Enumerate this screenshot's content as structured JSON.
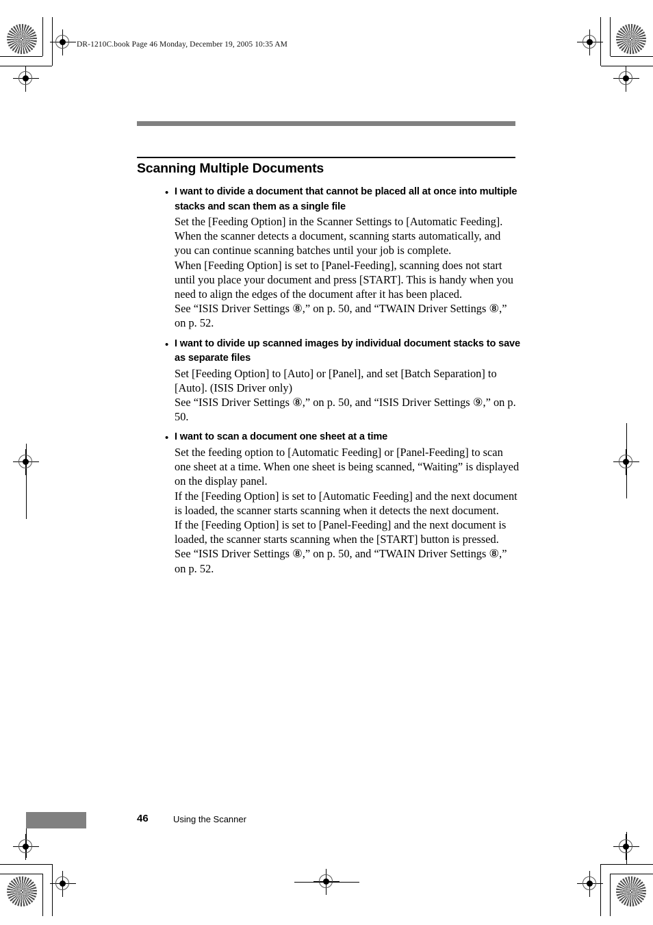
{
  "header": {
    "file_line": "DR-1210C.book  Page 46  Monday, December 19, 2005  10:35 AM"
  },
  "content": {
    "section_title": "Scanning Multiple Documents",
    "bullet_char": "•",
    "sections": [
      {
        "heading": "I want to divide a document that cannot be placed all at once into multiple stacks and scan them as a single file",
        "paragraphs": [
          "Set the [Feeding Option] in the Scanner Settings to [Automatic Feeding]. When the scanner detects a document, scanning starts automatically, and you can continue scanning batches until your job is complete.",
          "When [Feeding Option] is set to [Panel-Feeding], scanning does not start until you place your document and press [START]. This is handy when you need to align the edges of the document after it has been placed.",
          "See “ISIS Driver Settings ⑧,” on p. 50, and “TWAIN Driver Settings ⑧,” on p. 52."
        ]
      },
      {
        "heading": "I want to divide up scanned images by individual document stacks to save as separate files",
        "paragraphs": [
          "Set [Feeding Option] to [Auto] or [Panel], and set [Batch Separation] to [Auto]. (ISIS Driver only)",
          "See “ISIS Driver Settings ⑧,” on p. 50, and “ISIS Driver Settings ⑨,” on p. 50."
        ]
      },
      {
        "heading": "I want to scan a document one sheet at a time",
        "paragraphs": [
          "Set the feeding option to [Automatic Feeding] or [Panel-Feeding] to scan one sheet at a time. When one sheet is being scanned, “Waiting” is displayed on the display panel.",
          "If the [Feeding Option] is set to [Automatic Feeding] and the next document is loaded, the scanner starts scanning when it detects the next document.",
          "If the [Feeding Option] is set to [Panel-Feeding] and the next document is loaded, the scanner starts scanning when the [START] button is pressed.",
          "See “ISIS Driver Settings ⑧,” on p. 50, and “TWAIN Driver Settings ⑧,” on p. 52."
        ]
      }
    ]
  },
  "footer": {
    "page_number": "46",
    "label": "Using the Scanner"
  },
  "colors": {
    "gray_bar": "#808080",
    "text": "#000000"
  }
}
